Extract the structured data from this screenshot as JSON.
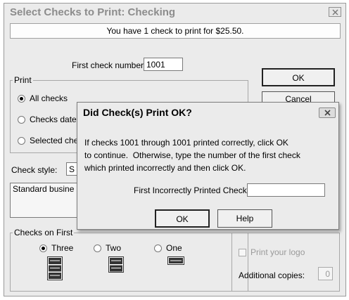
{
  "dialog": {
    "title": "Select Checks to Print: Checking",
    "info": "You have 1 check to print for $25.50.",
    "first_check_label": "First check number:",
    "first_check_value": "1001",
    "print_group": {
      "label": "Print",
      "options": [
        "All checks",
        "Checks date",
        "Selected che"
      ]
    },
    "ok_label": "OK",
    "cancel_label": "Cancel",
    "check_style_label": "Check style:",
    "check_style_value": "S",
    "description": "Standard busine checks...",
    "checks_on_first_group": {
      "label": "Checks on First",
      "options": [
        "Three",
        "Two",
        "One"
      ]
    },
    "print_logo_label": "Print your logo",
    "additional_copies_label": "Additional copies:",
    "additional_copies_value": "0"
  },
  "popup": {
    "title": "Did Check(s) Print OK?",
    "message_line1": "If checks 1001 through 1001 printed correctly, click OK",
    "message_line2": "to continue.  Otherwise, type the number of the first check",
    "message_line3": "which printed incorrectly and then click OK.",
    "field_label": "First Incorrectly Printed Check:",
    "field_value": "",
    "ok_label": "OK",
    "help_label": "Help"
  }
}
